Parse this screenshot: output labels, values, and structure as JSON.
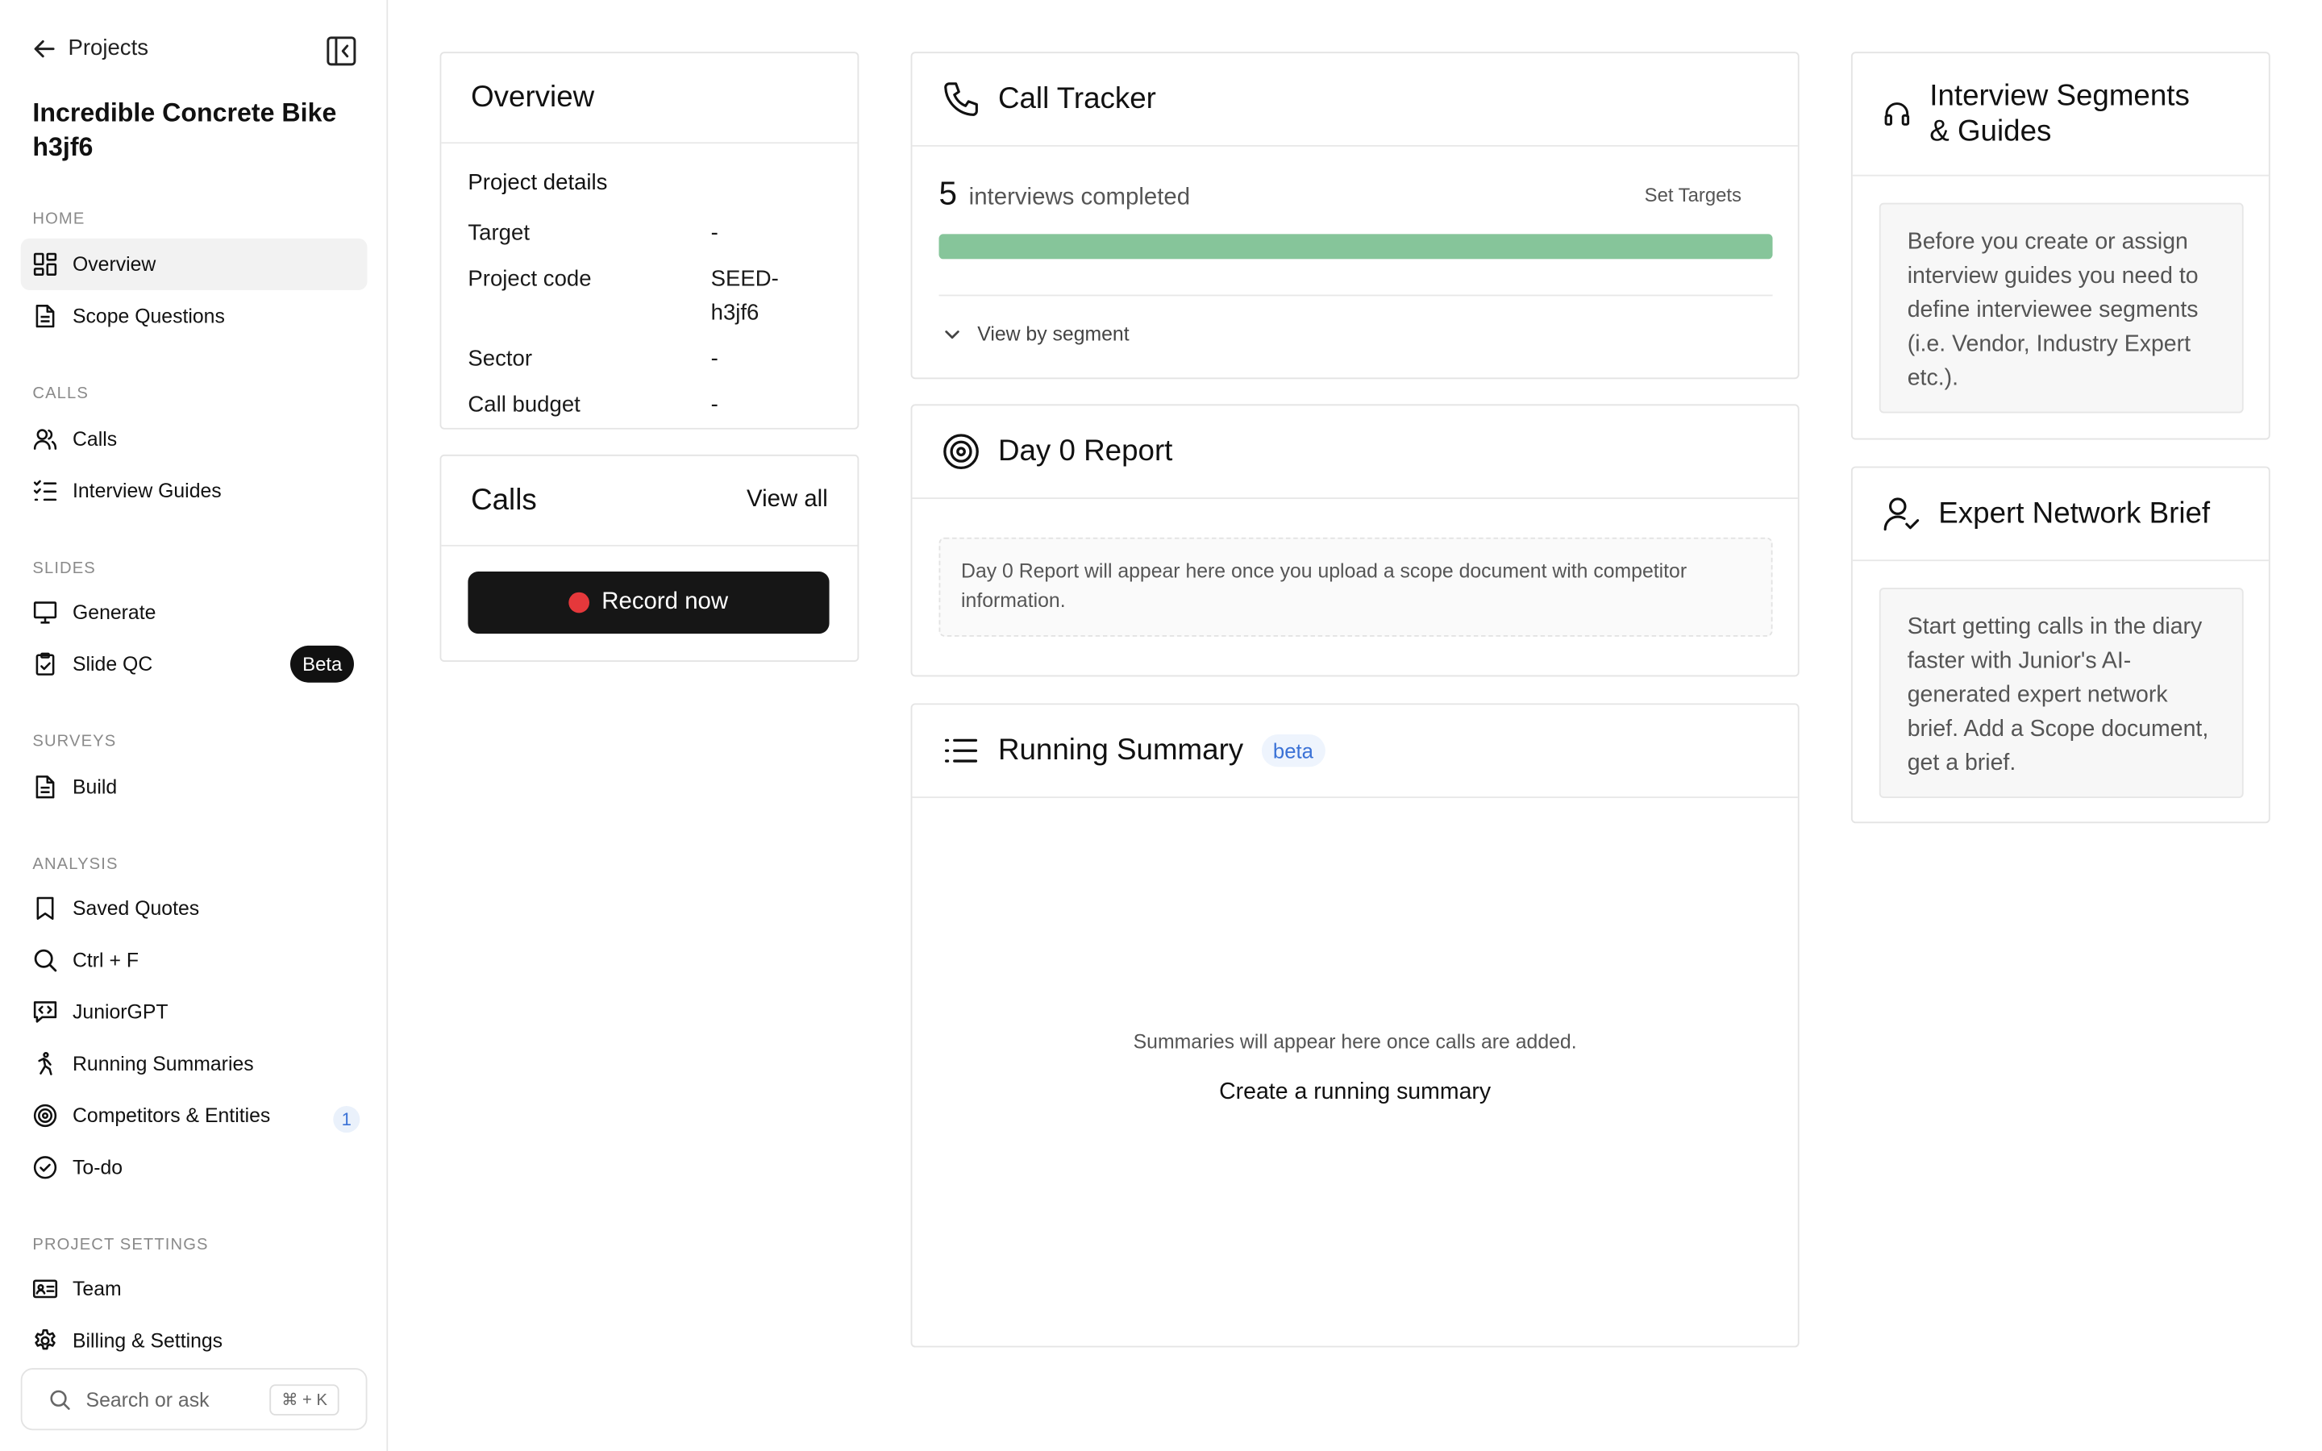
{
  "sidebar": {
    "back_label": "Projects",
    "project_title": "Incredible Concrete Bike h3jf6",
    "sections": {
      "home": "HOME",
      "calls": "CALLS",
      "slides": "SLIDES",
      "surveys": "SURVEYS",
      "analysis": "ANALYSIS",
      "project_settings": "PROJECT SETTINGS"
    },
    "items": {
      "overview": "Overview",
      "scope_questions": "Scope Questions",
      "calls": "Calls",
      "interview_guides": "Interview Guides",
      "generate": "Generate",
      "slide_qc": "Slide QC",
      "slide_qc_badge": "Beta",
      "build": "Build",
      "saved_quotes": "Saved Quotes",
      "ctrl_f": "Ctrl + F",
      "junior_gpt": "JuniorGPT",
      "running_summaries": "Running Summaries",
      "competitors": "Competitors & Entities",
      "competitors_count": "1",
      "todo": "To-do",
      "team": "Team",
      "billing": "Billing & Settings"
    },
    "search": {
      "placeholder": "Search or ask",
      "shortcut": "⌘ + K"
    }
  },
  "overview": {
    "title": "Overview",
    "heading": "Project details",
    "rows": [
      {
        "key": "Target",
        "value": "-"
      },
      {
        "key": "Project code",
        "value": "SEED-h3jf6"
      },
      {
        "key": "Sector",
        "value": "-"
      },
      {
        "key": "Call budget",
        "value": "-"
      }
    ]
  },
  "calls_card": {
    "title": "Calls",
    "view_all": "View all",
    "record_label": "Record now"
  },
  "call_tracker": {
    "title": "Call Tracker",
    "count": "5",
    "count_label": "interviews completed",
    "set_targets": "Set Targets",
    "progress_fraction": 1.0,
    "view_by_segment": "View by segment"
  },
  "day0": {
    "title": "Day 0 Report",
    "note": "Day 0 Report will appear here once you upload a scope document with competitor information."
  },
  "running_summary": {
    "title": "Running Summary",
    "badge": "beta",
    "empty_text": "Summaries will appear here once calls are added.",
    "create_link": "Create a running summary"
  },
  "segments": {
    "title_line1": "Interview Segments",
    "title_line2": "& Guides",
    "body": "Before you create or assign interview guides you need to define interviewee segments (i.e. Vendor, Industry Expert etc.)."
  },
  "expert_brief": {
    "title": "Expert Network Brief",
    "body": "Start getting calls in the diary faster with Junior's AI-generated expert network brief. Add a Scope document, get a brief."
  },
  "colors": {
    "progress": "#86c59a",
    "record_button": "#161616",
    "record_dot": "#e5383b",
    "accent_blue": "#3b72d6"
  }
}
